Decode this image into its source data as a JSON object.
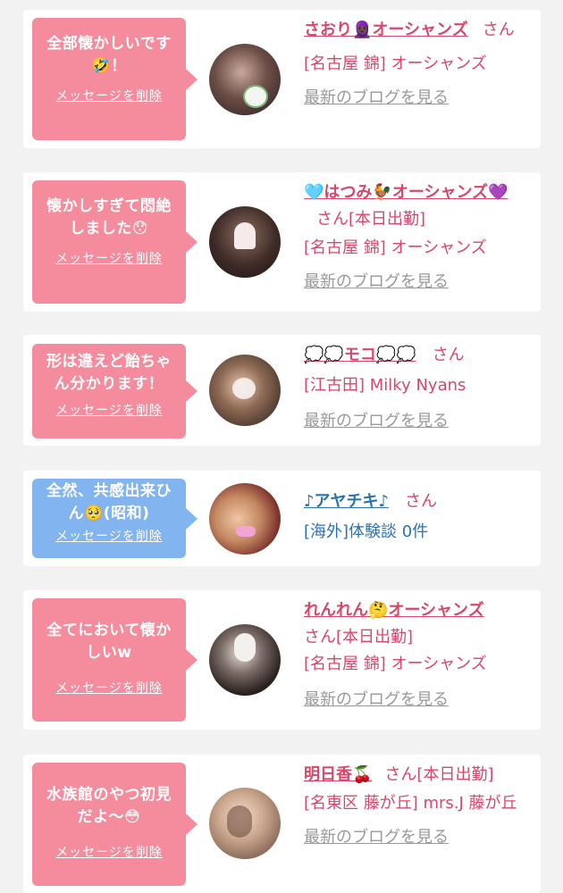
{
  "cards": [
    {
      "message": "全部懐かしいです🤣！",
      "delete_label": "メッセージを削除",
      "name": "さおり🧕🏿オーシャンズ",
      "suffix": "さん",
      "shop": "[名古屋 錦] オーシャンズ",
      "blog": "最新のブログを見る"
    },
    {
      "message": "懐かしすぎて悶絶しました😯",
      "delete_label": "メッセージを削除",
      "name": "🩵はつみ🐓オーシャンズ💜",
      "suffix": "さん",
      "tag": "[本日出勤]",
      "shop": "[名古屋 錦] オーシャンズ",
      "blog": "最新のブログを見る"
    },
    {
      "message": "形は違えど飴ちゃん分かります！",
      "delete_label": "メッセージを削除",
      "name": "💭💭モコ💭💭",
      "suffix": "さん",
      "shop": "[江古田] Milky Nyans",
      "blog": "最新のブログを見る"
    },
    {
      "message": "全然、共感出来ひん🥺(昭和)",
      "delete_label": "メッセージを削除",
      "name": "♪アヤチキ♪",
      "suffix": "さん",
      "shop": "[海外]体験談 0件"
    },
    {
      "message": "全てにおいて懐かしいw",
      "delete_label": "メッセージを削除",
      "name": "れんれん🤔オーシャンズ",
      "suffix": "さん",
      "tag": "[本日出勤]",
      "shop": "[名古屋 錦] オーシャンズ",
      "blog": "最新のブログを見る"
    },
    {
      "message": "水族館のやつ初見だよ〜😳",
      "delete_label": "メッセージを削除",
      "name": "明日香🍒",
      "suffix": "さん",
      "tag": "[本日出勤]",
      "shop": "[名東区 藤が丘] mrs.J 藤が丘",
      "blog": "最新のブログを見る"
    }
  ],
  "colors": {
    "bubble_pink": "#f58c9e",
    "bubble_blue": "#82b4ef",
    "name_pink": "#d7476b",
    "name_blue": "#2a72b4"
  }
}
